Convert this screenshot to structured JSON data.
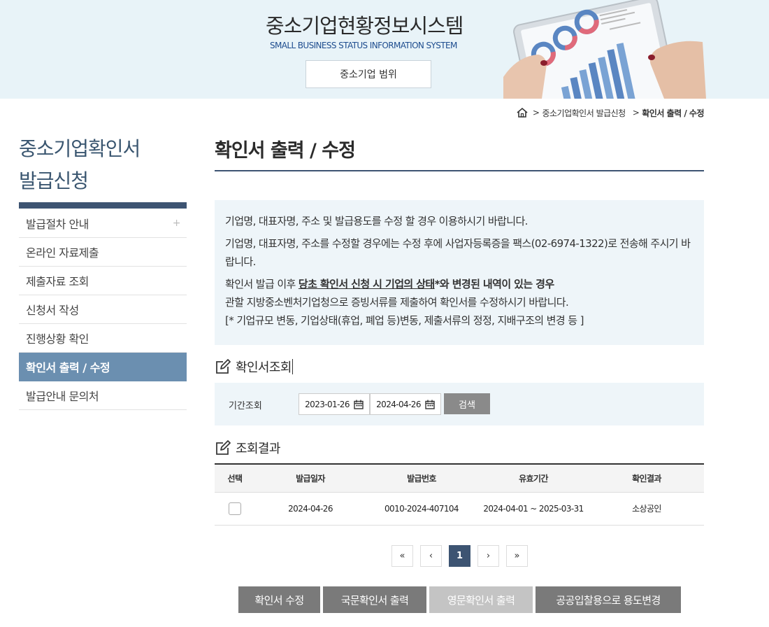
{
  "header": {
    "title": "중소기업현황정보시스템",
    "subtitle": "SMALL BUSINESS STATUS INFORMATION SYSTEM",
    "scope_button": "중소기업 범위"
  },
  "breadcrumb": {
    "level1": "중소기업확인서 발급신청",
    "level2": "확인서 출력 / 수정"
  },
  "sidebar": {
    "title_line1": "중소기업확인서",
    "title_line2": "발급신청",
    "items": [
      {
        "label": "발급절차 안내"
      },
      {
        "label": "온라인 자료제출"
      },
      {
        "label": "제출자료 조회"
      },
      {
        "label": "신청서 작성"
      },
      {
        "label": "진행상황 확인"
      },
      {
        "label": "확인서 출력 / 수정"
      },
      {
        "label": "발급안내 문의처"
      }
    ]
  },
  "main": {
    "title": "확인서 출력 / 수정",
    "notice": {
      "line1": "기업명, 대표자명, 주소 및 발급용도를 수정 할 경우 이용하시기 바랍니다.",
      "line2": "기업명, 대표자명, 주소를 수정할 경우에는 수정 후에 사업자등록증을 팩스(02-6974-1322)로 전송해 주시기 바랍니다.",
      "line3_prefix": "확인서 발급 이후 ",
      "line3_strong": "당초 확인서 신청 시 기업의 상태",
      "line3_suffix": "*와 변경된 내역이 있는 경우",
      "line4": "관할 지방중소벤처기업청으로 증빙서류를 제출하여 확인서를 수정하시기 바랍니다.",
      "line5": "[* 기업규모 변동, 기업상태(휴업, 폐업 등)변동, 제출서류의 정정, 지배구조의 변경 등 ]"
    },
    "search_section": {
      "title": "확인서조회",
      "period_label": "기간조회",
      "date_from": "2023-01-26",
      "date_to": "2024-04-26",
      "search_button": "검색"
    },
    "result_section": {
      "title": "조회결과",
      "columns": [
        "선택",
        "발급일자",
        "발급번호",
        "유효기간",
        "확인결과"
      ],
      "rows": [
        {
          "issue_date": "2024-04-26",
          "issue_no": "0010-2024-407104",
          "valid_period": "2024-04-01 ~ 2025-03-31",
          "result": "소상공인"
        }
      ]
    },
    "pagination": {
      "first": "«",
      "prev": "‹",
      "current": "1",
      "next": "›",
      "last": "»"
    },
    "actions": {
      "edit": "확인서 수정",
      "print_korean": "국문확인서 출력",
      "print_english": "영문확인서 출력",
      "change_usage": "공공입찰용으로 용도변경"
    }
  },
  "colors": {
    "header_bg": "#e8f3f8",
    "brand_navy": "#3d5472",
    "active_menu": "#6b8fb0",
    "button_gray": "#7a7a7a",
    "button_disabled": "#c4c4c4"
  },
  "icons": {
    "home": "home-icon",
    "edit": "pencil-square-icon",
    "calendar": "calendar-icon"
  }
}
